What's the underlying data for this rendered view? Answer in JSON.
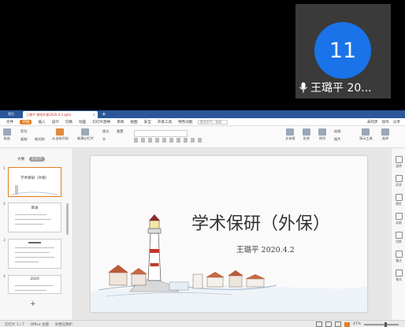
{
  "participant": {
    "tile_number": "11",
    "name": "王璐平 20..."
  },
  "app": {
    "home_tab": "首页",
    "doc_tab": "王璐平 保研外保2020.4.2.pptx",
    "menu": [
      "文件",
      "开始",
      "插入",
      "设计",
      "切换",
      "动画",
      "幻灯片放映",
      "审阅",
      "视图",
      "安全",
      "开发工具",
      "特色功能"
    ],
    "active_menu": "开始",
    "search_placeholder": "查找命令、搜索",
    "menu_right": [
      "未同步",
      "协作",
      "分享"
    ],
    "ribbon": {
      "paste": "粘贴",
      "cut": "剪切",
      "copy": "复制",
      "format_painter": "格式刷",
      "from_current": "从当前开始",
      "new_slide": "新建幻灯片",
      "layout": "版式",
      "section": "节",
      "reset": "重置",
      "textbox": "文本框",
      "shape": "形状",
      "arrange": "排列",
      "outline": "轮廓",
      "picture": "图片",
      "present_tools": "演示工具",
      "select": "选择"
    },
    "pane_tabs": [
      "大纲",
      "幻灯片"
    ],
    "active_pane_tab": "幻灯片",
    "thumbnails": [
      {
        "num": "1",
        "title": "学术保研（外保）"
      },
      {
        "num": "2",
        "title": "目录"
      },
      {
        "num": "3",
        "title": ""
      },
      {
        "num": "4",
        "title": "2020"
      }
    ],
    "slide": {
      "title": "学术保研（外保）",
      "subtitle": "王璐平  2020.4.2"
    },
    "right_bar": [
      "选择",
      "形状",
      "属性",
      "动画",
      "切换",
      "备注",
      "格式"
    ],
    "status": {
      "slide_no": "幻灯片 1 / 7",
      "theme": "Office 主题",
      "backup": "文档已保护",
      "zoom": "47%"
    }
  }
}
